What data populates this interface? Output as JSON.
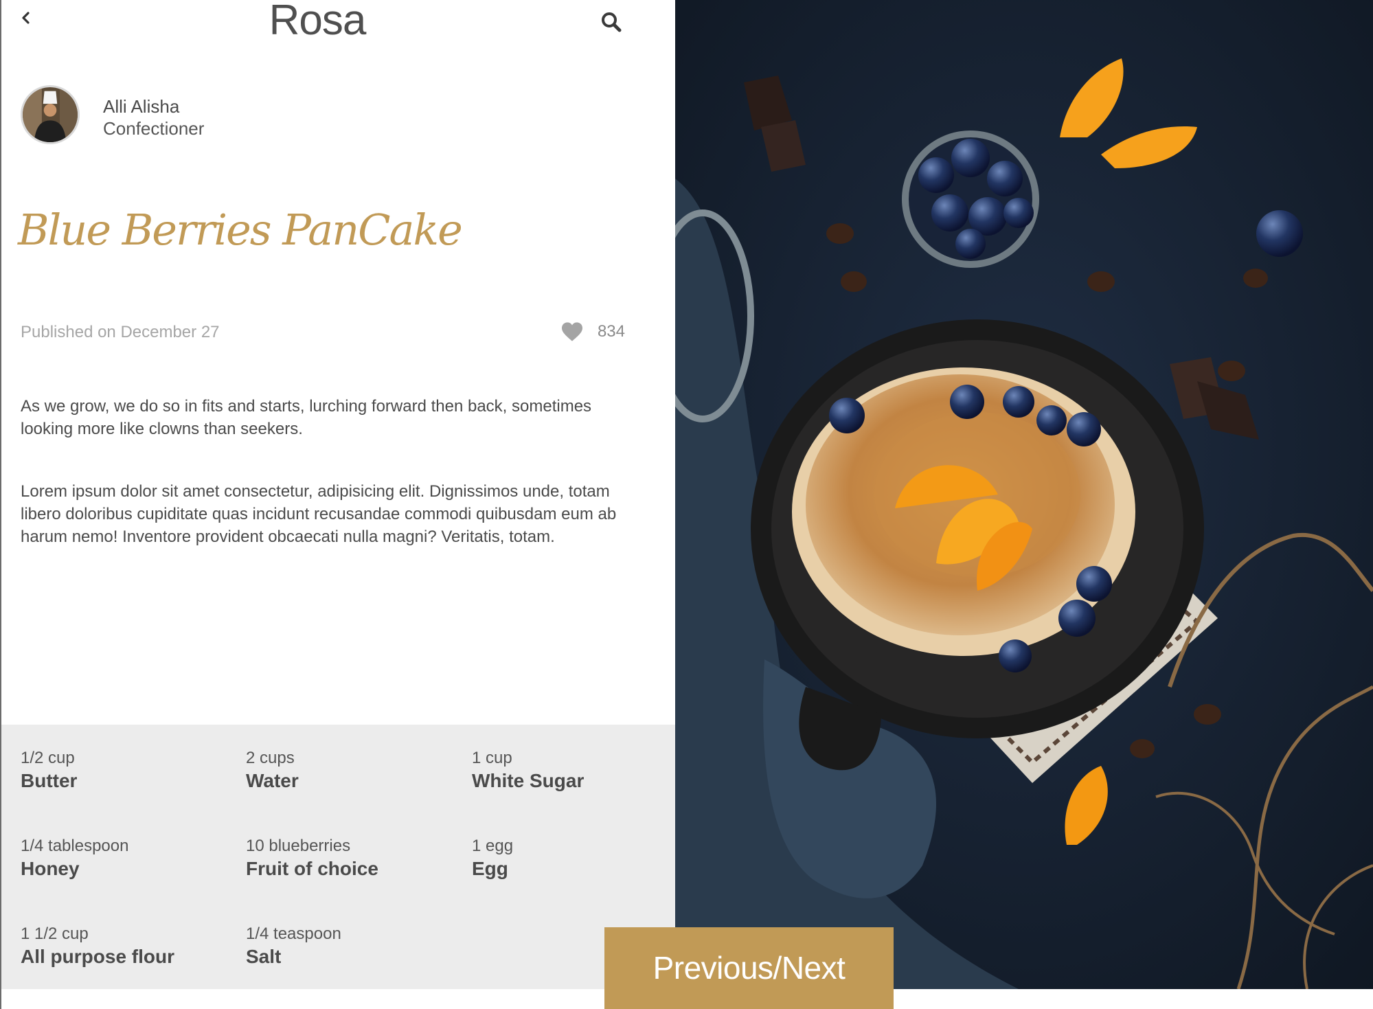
{
  "header": {
    "title": "Rosa",
    "back_icon": "chevron-left-icon",
    "search_icon": "search-icon"
  },
  "author": {
    "name": "Alli Alisha",
    "role": "Confectioner"
  },
  "recipe": {
    "title": "Blue Berries PanCake",
    "published": "Published on December 27",
    "likes": "834",
    "paragraphs": [
      "As we grow, we do so in fits and starts, lurching forward then back, sometimes looking more like clowns than seekers.",
      "Lorem ipsum dolor sit amet consectetur, adipisicing elit. Dignissimos unde, totam libero doloribus cupiditate quas incidunt recusandae commodi quibusdam eum ab harum nemo! Inventore provident obcaecati nulla magni? Veritatis, totam."
    ]
  },
  "ingredients": [
    {
      "amount": "1/2 cup",
      "name": "Butter"
    },
    {
      "amount": "2 cups",
      "name": "Water"
    },
    {
      "amount": "1 cup",
      "name": "White Sugar"
    },
    {
      "amount": "1/4 tablespoon",
      "name": "Honey"
    },
    {
      "amount": "10 blueberries",
      "name": "Fruit of choice"
    },
    {
      "amount": "1 egg",
      "name": "Egg"
    },
    {
      "amount": "1 1/2 cup",
      "name": "All purpose flour"
    },
    {
      "amount": "1/4 teaspoon",
      "name": "Salt"
    }
  ],
  "nav": {
    "prev_next_label": "Previous/Next"
  },
  "colors": {
    "accent": "#c19a56",
    "ingredients_bg": "#ececec",
    "photo_bg": "#16202e"
  }
}
